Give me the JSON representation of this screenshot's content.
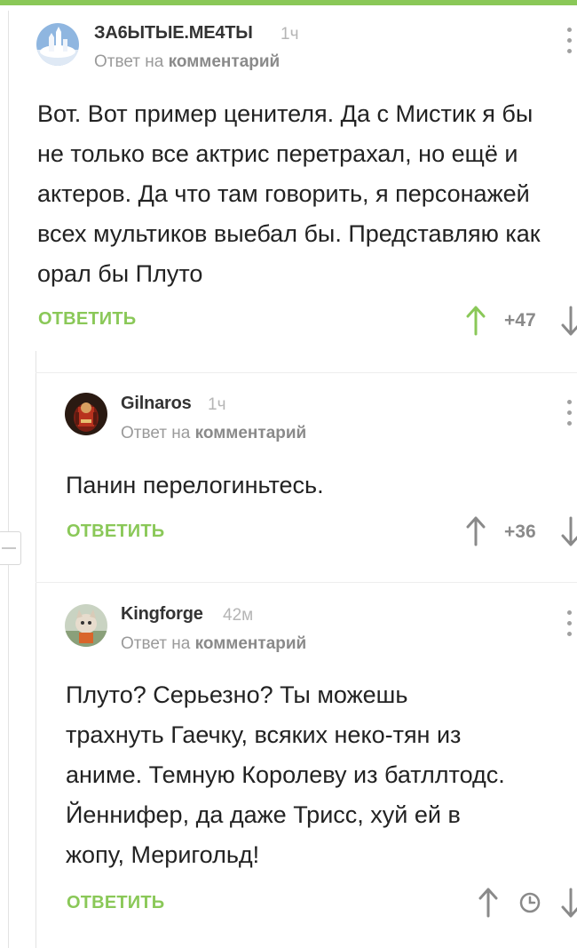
{
  "comments": [
    {
      "author": "ЗА6ЫТЫЕ.МЕ4ТЫ",
      "time": "1ч",
      "meta_prefix": "Ответ на",
      "meta_link": "комментарий",
      "body": "Вот. Вот пример ценителя. Да с Мистик я бы не только все актрис перетрахал, но ещё и актеров. Да что там говорить, я персонажей всех мультиков выебал бы. Представляю как орал бы Плуто",
      "reply_label": "ОТВЕТИТЬ",
      "score": "+47",
      "voted_up": true
    },
    {
      "author": "Gilnaros",
      "time": "1ч",
      "meta_prefix": "Ответ на",
      "meta_link": "комментарий",
      "body": "Панин перелогиньтесь.",
      "reply_label": "ОТВЕТИТЬ",
      "score": "+36",
      "voted_up": false
    },
    {
      "author": "Kingforge",
      "time": "42м",
      "meta_prefix": "Ответ на",
      "meta_link": "комментарий",
      "body": "Плуто? Серьезно? Ты можешь трахнуть Гаечку, всяких неко-тян из аниме. Темную Королеву из батллтодс. Йеннифер, да даже Трисс, хуй ей в жопу, Меригольд!",
      "reply_label": "ОТВЕТИТЬ",
      "score_hidden": true
    }
  ],
  "colors": {
    "accent": "#8ac858",
    "vote_up_active": "#8ac858",
    "muted": "#9a9a9a"
  },
  "icons": [
    "more-vertical-icon",
    "arrow-up-icon",
    "arrow-down-icon",
    "clock-icon",
    "collapse-icon"
  ]
}
